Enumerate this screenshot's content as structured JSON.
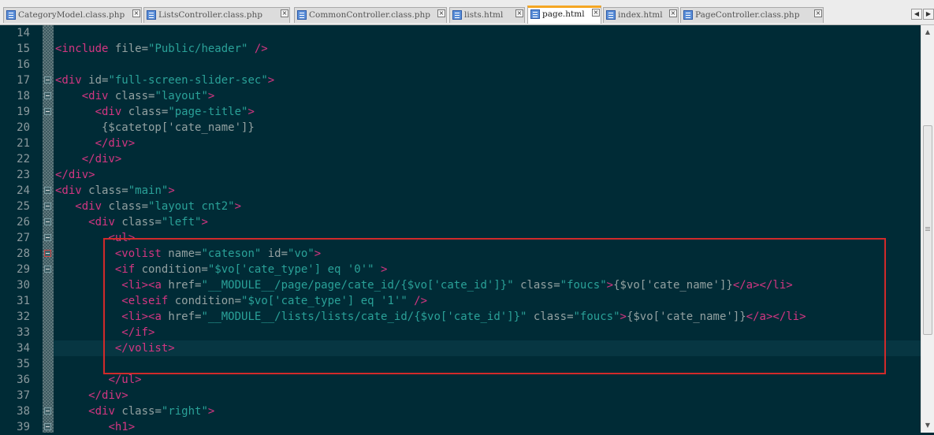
{
  "tabs": [
    {
      "label": "CategoryModel.class.php",
      "active": false
    },
    {
      "label": "ListsController.class.php",
      "active": false
    },
    {
      "label": "CommonController.class.php",
      "active": false
    },
    {
      "label": "lists.html",
      "active": false
    },
    {
      "label": "page.html",
      "active": true
    },
    {
      "label": "index.html",
      "active": false
    },
    {
      "label": "PageController.class.php",
      "active": false
    }
  ],
  "tab_close_glyph": "×",
  "nav": {
    "prev": "◀",
    "next": "▶"
  },
  "scroll": {
    "up": "▲",
    "down": "▼"
  },
  "colors": {
    "background": "#002b36",
    "tag": "#d33682",
    "attr": "#93a1a1",
    "string": "#2aa198",
    "text": "#93a1a1",
    "highlight_box": "#d12a2a"
  },
  "code_lines": [
    {
      "n": "14",
      "fold": false,
      "red": false,
      "segs": []
    },
    {
      "n": "15",
      "fold": false,
      "red": false,
      "segs": [
        {
          "t": "<include ",
          "c": "tag"
        },
        {
          "t": "file=",
          "c": "attr"
        },
        {
          "t": "\"Public/header\"",
          "c": "string"
        },
        {
          "t": " />",
          "c": "tag"
        }
      ]
    },
    {
      "n": "16",
      "fold": false,
      "red": false,
      "segs": []
    },
    {
      "n": "17",
      "fold": true,
      "red": false,
      "segs": [
        {
          "t": "<div ",
          "c": "tag"
        },
        {
          "t": "id=",
          "c": "attr"
        },
        {
          "t": "\"full-screen-slider-sec\"",
          "c": "string"
        },
        {
          "t": ">",
          "c": "tag"
        }
      ]
    },
    {
      "n": "18",
      "fold": true,
      "red": false,
      "segs": [
        {
          "t": "    "
        },
        {
          "t": "<div ",
          "c": "tag"
        },
        {
          "t": "class=",
          "c": "attr"
        },
        {
          "t": "\"layout\"",
          "c": "string"
        },
        {
          "t": ">",
          "c": "tag"
        }
      ]
    },
    {
      "n": "19",
      "fold": true,
      "red": false,
      "segs": [
        {
          "t": "      "
        },
        {
          "t": "<div ",
          "c": "tag"
        },
        {
          "t": "class=",
          "c": "attr"
        },
        {
          "t": "\"page-title\"",
          "c": "string"
        },
        {
          "t": ">",
          "c": "tag"
        }
      ]
    },
    {
      "n": "20",
      "fold": false,
      "red": false,
      "segs": [
        {
          "t": "       {$catetop['cate_name']}",
          "c": "text"
        }
      ]
    },
    {
      "n": "21",
      "fold": false,
      "red": false,
      "segs": [
        {
          "t": "      "
        },
        {
          "t": "</div>",
          "c": "tag"
        }
      ]
    },
    {
      "n": "22",
      "fold": false,
      "red": false,
      "segs": [
        {
          "t": "    "
        },
        {
          "t": "</div>",
          "c": "tag"
        }
      ]
    },
    {
      "n": "23",
      "fold": false,
      "red": false,
      "segs": [
        {
          "t": "</div>",
          "c": "tag"
        }
      ]
    },
    {
      "n": "24",
      "fold": true,
      "red": false,
      "segs": [
        {
          "t": "<div ",
          "c": "tag"
        },
        {
          "t": "class=",
          "c": "attr"
        },
        {
          "t": "\"main\"",
          "c": "string"
        },
        {
          "t": ">",
          "c": "tag"
        }
      ]
    },
    {
      "n": "25",
      "fold": true,
      "red": false,
      "segs": [
        {
          "t": "   "
        },
        {
          "t": "<div ",
          "c": "tag"
        },
        {
          "t": "class=",
          "c": "attr"
        },
        {
          "t": "\"layout cnt2\"",
          "c": "string"
        },
        {
          "t": ">",
          "c": "tag"
        }
      ]
    },
    {
      "n": "26",
      "fold": true,
      "red": false,
      "segs": [
        {
          "t": "     "
        },
        {
          "t": "<div ",
          "c": "tag"
        },
        {
          "t": "class=",
          "c": "attr"
        },
        {
          "t": "\"left\"",
          "c": "string"
        },
        {
          "t": ">",
          "c": "tag"
        }
      ]
    },
    {
      "n": "27",
      "fold": true,
      "red": false,
      "segs": [
        {
          "t": "        "
        },
        {
          "t": "<ul>",
          "c": "tag"
        }
      ]
    },
    {
      "n": "28",
      "fold": true,
      "red": true,
      "segs": [
        {
          "t": "         "
        },
        {
          "t": "<volist ",
          "c": "tag"
        },
        {
          "t": "name=",
          "c": "attr"
        },
        {
          "t": "\"cateson\"",
          "c": "string"
        },
        {
          "t": " "
        },
        {
          "t": "id=",
          "c": "attr"
        },
        {
          "t": "\"vo\"",
          "c": "string"
        },
        {
          "t": ">",
          "c": "tag"
        }
      ]
    },
    {
      "n": "29",
      "fold": true,
      "red": false,
      "segs": [
        {
          "t": "         "
        },
        {
          "t": "<if ",
          "c": "tag"
        },
        {
          "t": "condition=",
          "c": "attr"
        },
        {
          "t": "\"$vo['cate_type'] eq '0'\"",
          "c": "string"
        },
        {
          "t": " >",
          "c": "tag"
        }
      ]
    },
    {
      "n": "30",
      "fold": false,
      "red": false,
      "segs": [
        {
          "t": "          "
        },
        {
          "t": "<li>",
          "c": "tag"
        },
        {
          "t": "<a ",
          "c": "tag"
        },
        {
          "t": "href=",
          "c": "attr"
        },
        {
          "t": "\"__MODULE__/page/page/cate_id/{$vo['cate_id']}\"",
          "c": "string"
        },
        {
          "t": " "
        },
        {
          "t": "class=",
          "c": "attr"
        },
        {
          "t": "\"foucs\"",
          "c": "string"
        },
        {
          "t": ">",
          "c": "tag"
        },
        {
          "t": "{$vo['cate_name']}",
          "c": "text"
        },
        {
          "t": "</a></li>",
          "c": "tag"
        }
      ]
    },
    {
      "n": "31",
      "fold": false,
      "red": false,
      "segs": [
        {
          "t": "          "
        },
        {
          "t": "<elseif ",
          "c": "tag"
        },
        {
          "t": "condition=",
          "c": "attr"
        },
        {
          "t": "\"$vo['cate_type'] eq '1'\"",
          "c": "string"
        },
        {
          "t": " />",
          "c": "tag"
        }
      ]
    },
    {
      "n": "32",
      "fold": false,
      "red": false,
      "segs": [
        {
          "t": "          "
        },
        {
          "t": "<li>",
          "c": "tag"
        },
        {
          "t": "<a ",
          "c": "tag"
        },
        {
          "t": "href=",
          "c": "attr"
        },
        {
          "t": "\"__MODULE__/lists/lists/cate_id/{$vo['cate_id']}\"",
          "c": "string"
        },
        {
          "t": " "
        },
        {
          "t": "class=",
          "c": "attr"
        },
        {
          "t": "\"foucs\"",
          "c": "string"
        },
        {
          "t": ">",
          "c": "tag"
        },
        {
          "t": "{$vo['cate_name']}",
          "c": "text"
        },
        {
          "t": "</a></li>",
          "c": "tag"
        }
      ]
    },
    {
      "n": "33",
      "fold": false,
      "red": false,
      "segs": [
        {
          "t": "          "
        },
        {
          "t": "</if>",
          "c": "tag"
        }
      ]
    },
    {
      "n": "34",
      "fold": false,
      "red": false,
      "segs": [
        {
          "t": "         "
        },
        {
          "t": "</volist>",
          "c": "tag"
        }
      ]
    },
    {
      "n": "35",
      "fold": false,
      "red": false,
      "segs": []
    },
    {
      "n": "36",
      "fold": false,
      "red": false,
      "segs": [
        {
          "t": "        "
        },
        {
          "t": "</ul>",
          "c": "tag"
        }
      ]
    },
    {
      "n": "37",
      "fold": false,
      "red": false,
      "segs": [
        {
          "t": "     "
        },
        {
          "t": "</div>",
          "c": "tag"
        }
      ]
    },
    {
      "n": "38",
      "fold": true,
      "red": false,
      "segs": [
        {
          "t": "     "
        },
        {
          "t": "<div ",
          "c": "tag"
        },
        {
          "t": "class=",
          "c": "attr"
        },
        {
          "t": "\"right\"",
          "c": "string"
        },
        {
          "t": ">",
          "c": "tag"
        }
      ]
    },
    {
      "n": "39",
      "fold": true,
      "red": false,
      "segs": [
        {
          "t": "        "
        },
        {
          "t": "<h1>",
          "c": "tag"
        }
      ]
    }
  ]
}
